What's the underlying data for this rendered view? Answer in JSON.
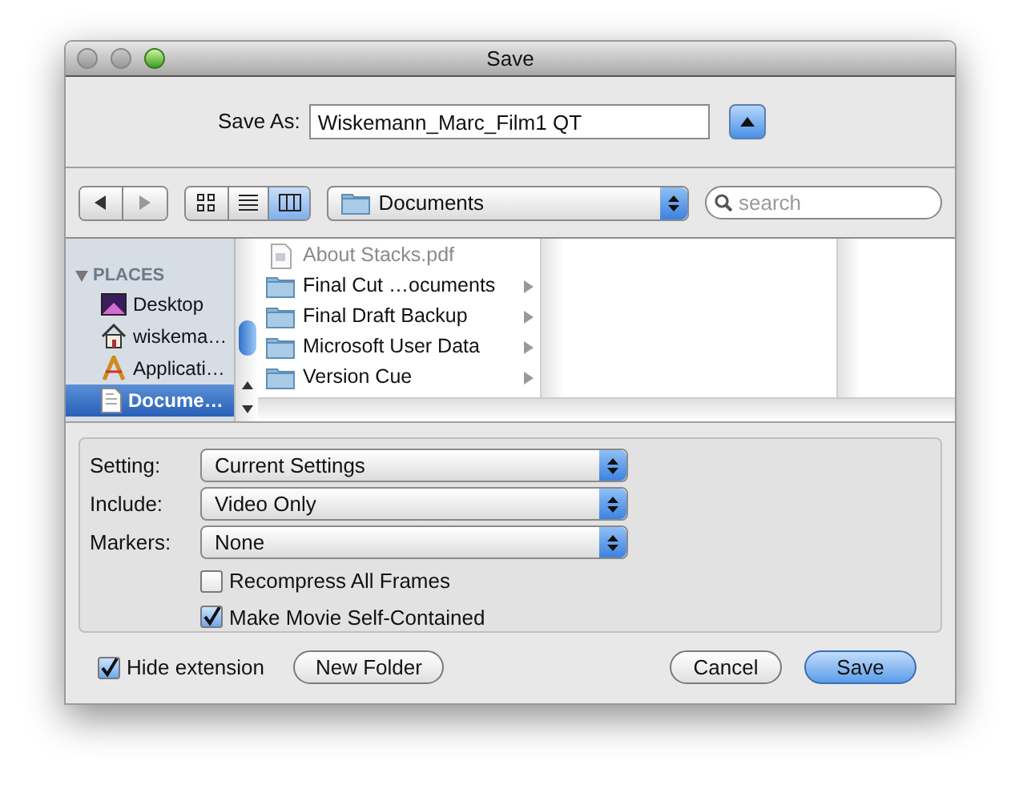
{
  "window": {
    "title": "Save"
  },
  "save_as": {
    "label": "Save As:",
    "value": "Wiskemann_Marc_Film1 QT",
    "expanded": false
  },
  "toolbar": {
    "views": [
      {
        "kind": "icon",
        "selected": false
      },
      {
        "kind": "list",
        "selected": false
      },
      {
        "kind": "column",
        "selected": true
      }
    ],
    "location": "Documents",
    "search": {
      "placeholder": "search"
    }
  },
  "sidebar": {
    "section": "PLACES",
    "expanded": true,
    "items": [
      {
        "label": "Desktop",
        "kind": "desktop",
        "selected": false
      },
      {
        "label": "wiskema…",
        "kind": "home",
        "selected": false
      },
      {
        "label": "Applicati…",
        "kind": "apps",
        "selected": false
      },
      {
        "label": "Docume…",
        "kind": "docs",
        "selected": true
      }
    ]
  },
  "files": [
    {
      "label": "About Stacks.pdf",
      "kind": "file",
      "disabled": true
    },
    {
      "label": "Final Cut …ocuments",
      "kind": "folder",
      "disabled": false
    },
    {
      "label": "Final Draft Backup",
      "kind": "folder",
      "disabled": false
    },
    {
      "label": "Microsoft User Data",
      "kind": "folder",
      "disabled": false
    },
    {
      "label": "Version Cue",
      "kind": "folder",
      "disabled": false
    }
  ],
  "options": [
    {
      "label": "Setting:",
      "value": "Current Settings"
    },
    {
      "label": "Include:",
      "value": "Video Only"
    },
    {
      "label": "Markers:",
      "value": "None"
    }
  ],
  "checkboxes": [
    {
      "label": "Recompress All Frames",
      "checked": false
    },
    {
      "label": "Make Movie Self-Contained",
      "checked": true
    }
  ],
  "hide_extension": {
    "label": "Hide extension",
    "checked": true
  },
  "buttons": [
    {
      "label": "New Folder",
      "kind": "plain"
    },
    {
      "label": "Cancel",
      "kind": "plain"
    },
    {
      "label": "Save",
      "kind": "default"
    }
  ]
}
